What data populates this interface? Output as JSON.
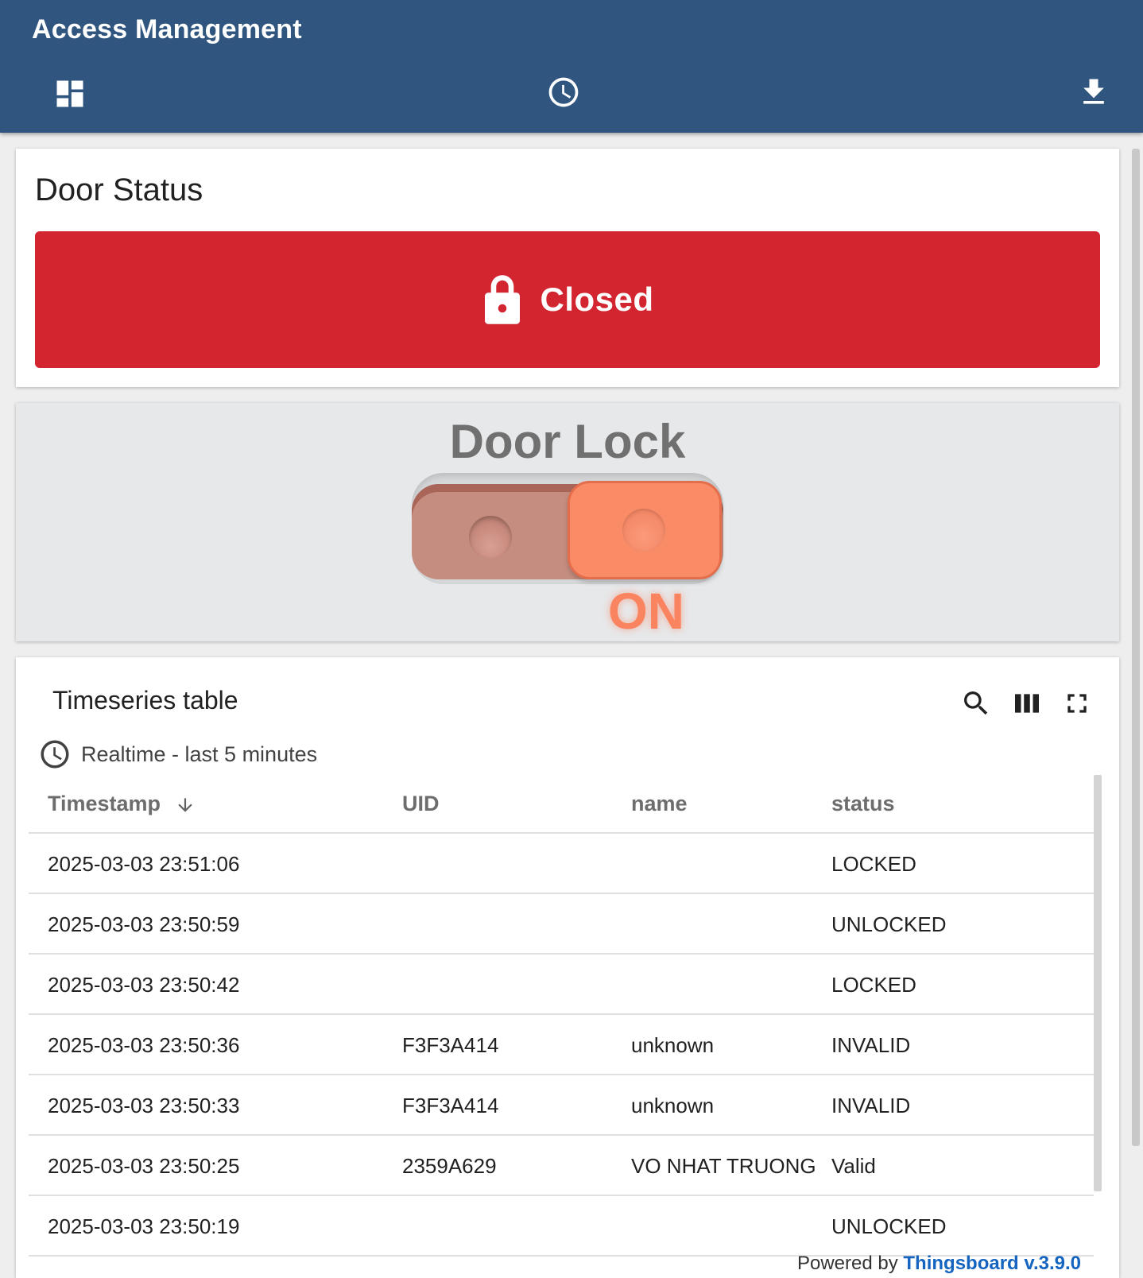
{
  "app": {
    "title": "Access Management"
  },
  "toolbar": {
    "icons": [
      "dashboard-icon",
      "history-icon",
      "download-icon"
    ]
  },
  "door_status": {
    "title": "Door Status",
    "value": "Closed",
    "icon": "lock-icon",
    "color": "#d22530"
  },
  "door_lock": {
    "title": "Door Lock",
    "state_label": "ON",
    "state": true,
    "accent_color": "#f98b67"
  },
  "timeseries": {
    "title": "Timeseries table",
    "timewindow": "Realtime - last 5 minutes",
    "actions": [
      "search-icon",
      "columns-icon",
      "fullscreen-icon"
    ],
    "columns": [
      "Timestamp",
      "UID",
      "name",
      "status"
    ],
    "sort": "descending",
    "rows": [
      {
        "timestamp": "2025-03-03 23:51:06",
        "uid": "",
        "name": "",
        "status": "LOCKED"
      },
      {
        "timestamp": "2025-03-03 23:50:59",
        "uid": "",
        "name": "",
        "status": "UNLOCKED"
      },
      {
        "timestamp": "2025-03-03 23:50:42",
        "uid": "",
        "name": "",
        "status": "LOCKED"
      },
      {
        "timestamp": "2025-03-03 23:50:36",
        "uid": "F3F3A414",
        "name": "unknown",
        "status": "INVALID"
      },
      {
        "timestamp": "2025-03-03 23:50:33",
        "uid": "F3F3A414",
        "name": "unknown",
        "status": "INVALID"
      },
      {
        "timestamp": "2025-03-03 23:50:25",
        "uid": "2359A629",
        "name": "VO NHAT TRUONG",
        "status": "Valid"
      },
      {
        "timestamp": "2025-03-03 23:50:19",
        "uid": "",
        "name": "",
        "status": "UNLOCKED"
      }
    ]
  },
  "footer": {
    "prefix": "Powered by",
    "link_text": "Thingsboard v.3.9.0",
    "link_color": "#1565c0"
  }
}
